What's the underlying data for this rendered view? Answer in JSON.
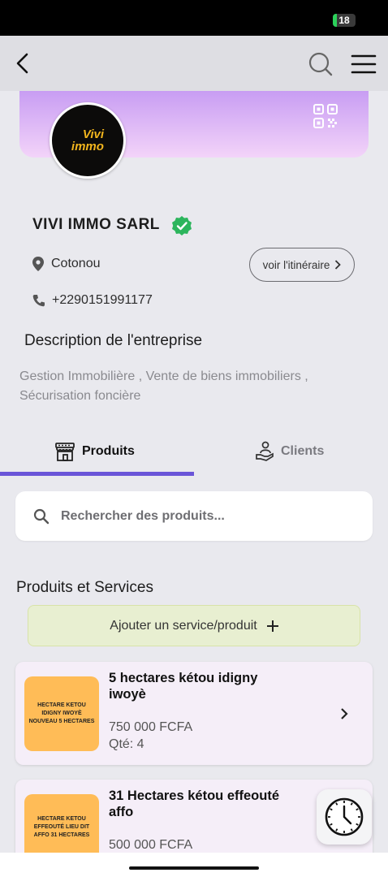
{
  "status_bar": {
    "battery_level": "18",
    "battery_color": "#2bd15a"
  },
  "app_bar": {
    "back_icon": "arrow-left-icon",
    "search_icon": "search-icon",
    "menu_icon": "hamburger-menu-icon"
  },
  "header": {
    "qr_icon": "qr-code-icon",
    "logo_text_line1": "Vivi",
    "logo_text_line2": "immo",
    "banner_gradient": [
      "#c89df3",
      "#f3d4f9"
    ]
  },
  "company": {
    "name": "VIVI IMMO SARL",
    "verified_icon": "verified-check-icon",
    "city": "Cotonou",
    "phone": "+2290151991177",
    "route_button": "voir l'itinéraire",
    "description_title": "Description de l'entreprise",
    "description": "Gestion Immobilière ,  Vente de biens immobiliers , Sécurisation foncière"
  },
  "tabs": [
    {
      "label": "Produits",
      "icon": "store-icon",
      "active": true
    },
    {
      "label": "Clients",
      "icon": "client-hand-icon",
      "active": false
    }
  ],
  "accent_color": "#6a55d8",
  "search": {
    "placeholder": "Rechercher des produits..."
  },
  "products_section": {
    "title": "Produits et Services",
    "add_button": "Ajouter un service/produit"
  },
  "products": [
    {
      "thumb_text": "HECTARE KETOU IDIGNY IWOYÈ NOUVEAU 5 HECTARES",
      "title": "5 hectares kétou idigny iwoyè",
      "price": "750 000 FCFA",
      "qty": "Qté: 4"
    },
    {
      "thumb_text": "HECTARE KETOU EFFEOUTÉ LIEU DIT AFFO 31 HECTARES",
      "title": "31 Hectares kétou effeouté affo",
      "price": "500 000 FCFA"
    }
  ],
  "floating": {
    "history_icon": "clock-icon"
  }
}
